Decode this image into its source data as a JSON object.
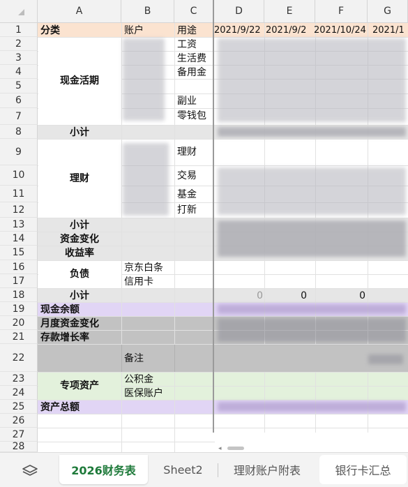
{
  "columns": [
    "A",
    "B",
    "C",
    "D",
    "E",
    "F",
    "G"
  ],
  "rows": [
    "1",
    "2",
    "3",
    "4",
    "5",
    "6",
    "7",
    "8",
    "9",
    "10",
    "11",
    "12",
    "13",
    "14",
    "15",
    "16",
    "17",
    "18",
    "19",
    "20",
    "21",
    "22",
    "23",
    "24",
    "25",
    "26",
    "27",
    "28"
  ],
  "header_row": {
    "a": "分类",
    "b": "账户",
    "c": "用途",
    "d": "2021/9/22",
    "e": "2021/9/2",
    "f": "2021/10/24",
    "g": "2021/1"
  },
  "categories": {
    "cash": "现金活期",
    "subtotal": "小计",
    "invest": "理财",
    "subtotal2": "小计",
    "fund_change": "资金变化",
    "yield_rate": "收益率",
    "debt": "负债",
    "subtotal3": "小计",
    "cash_balance": "现金余额",
    "monthly_change": "月度资金变化",
    "deposit_growth": "存款增长率",
    "special_assets": "专项资产",
    "total_assets": "资产总额"
  },
  "uses": {
    "salary": "工资",
    "living": "生活费",
    "reserve": "备用金",
    "side": "副业",
    "pocket": "零钱包",
    "finance": "理财",
    "trade": "交易",
    "fund": "基金",
    "ipo": "打新"
  },
  "accounts": {
    "jd": "京东白条",
    "credit": "信用卡",
    "note": "备注",
    "housing_fund": "公积金",
    "medical": "医保账户"
  },
  "values": {
    "row18_d": "0",
    "row18_e": "0",
    "row18_f": "0"
  },
  "tabs": {
    "layers_icon": "layers-icon",
    "t1": "2026财务表",
    "t2": "Sheet2",
    "t3": "理财账户附表",
    "t4": "银行卡汇总"
  },
  "colors": {
    "header_orange": "#fbe3d0",
    "gray": "#e6e6e6",
    "dark_gray": "#c2c2c2",
    "purple": "#e1d5f5",
    "green": "#e3f1dc",
    "active_tab": "#1e7a3a"
  }
}
